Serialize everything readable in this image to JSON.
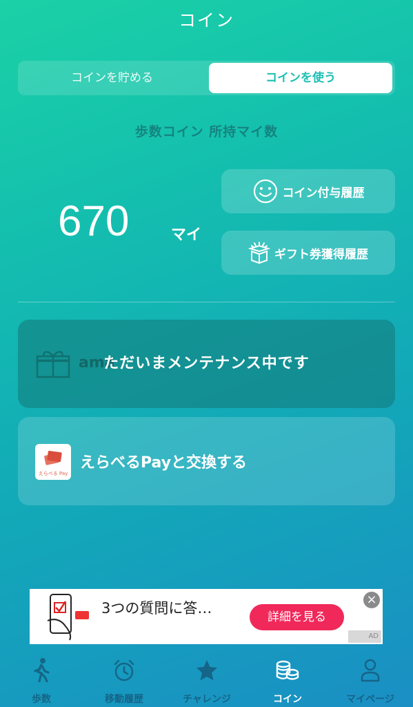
{
  "header": {
    "title": "コイン"
  },
  "segment": {
    "left_label": "コインを貯める",
    "right_label": "コインを使う"
  },
  "balance": {
    "label": "歩数コイン 所持マイ数",
    "value": "670",
    "unit": "マイ"
  },
  "actions": {
    "coin_history": "コイン付与履歴",
    "gift_history": "ギフト券獲得履歴"
  },
  "maintenance_card": {
    "ghost_text": "ama",
    "overlay": "ただいまメンテナンス中です"
  },
  "pay_card": {
    "logo_text": "えらべる Pay",
    "label": "えらべるPayと交換する"
  },
  "ad": {
    "text": "3つの質問に答…",
    "cta": "詳細を見る",
    "close": "×",
    "badge": "AD"
  },
  "tabs": [
    {
      "label": "歩数",
      "icon": "walking-icon"
    },
    {
      "label": "移動履歴",
      "icon": "alarm-clock-icon"
    },
    {
      "label": "チャレンジ",
      "icon": "star-icon"
    },
    {
      "label": "コイン",
      "icon": "coins-icon"
    },
    {
      "label": "マイページ",
      "icon": "person-icon"
    }
  ],
  "colors": {
    "accent": "#1bbfb3",
    "ad_cta": "#f0295a",
    "tab_inactive": "#3c6a80",
    "tab_active": "#ffffff"
  }
}
